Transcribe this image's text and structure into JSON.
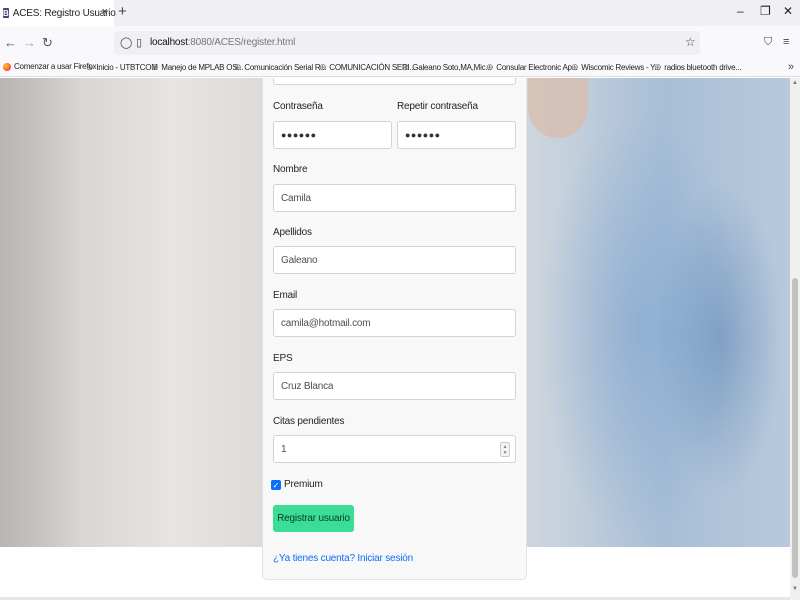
{
  "browser": {
    "tab_title": "ACES: Registro Usuario",
    "tab_close": "×",
    "new_tab": "+",
    "favicon_letter": "B",
    "window_controls": {
      "minimize": "–",
      "restore": "❐",
      "close": "✕"
    },
    "url_host": "localhost",
    "url_rest": ":8080/ACES/register.html",
    "bookmarks": [
      "Comenzar a usar Firefox",
      "Inicio - UTBTCOM",
      "Manejo de MPLAB OS...",
      "Comunicación Serial R...",
      "COMUNICACIÓN SERI...",
      "Galeano Soto,MA,Mic...",
      "Consular Electronic Ap...",
      "Wiscomic Reviews - Y...",
      "radios bluetooth drive..."
    ],
    "bookmarks_more": "»"
  },
  "form": {
    "password_label": "Contraseña",
    "repeat_password_label": "Repetir contraseña",
    "password_value": "●●●●●●",
    "repeat_password_value": "●●●●●●",
    "name_label": "Nombre",
    "name_value": "Camila",
    "lastname_label": "Apellidos",
    "lastname_value": "Galeano",
    "email_label": "Email",
    "email_value": "camila@hotmail.com",
    "eps_label": "EPS",
    "eps_value": "Cruz Blanca",
    "appointments_label": "Citas pendientes",
    "appointments_value": "1",
    "premium_label": "Premium",
    "premium_checked": true,
    "submit_label": "Registrar usuario",
    "login_link": "¿Ya tienes cuenta? Iniciar sesión"
  },
  "colors": {
    "button_bg": "#3bdd96",
    "link": "#0d6efd",
    "checkbox": "#0d6efd",
    "favicon": "#563d7c"
  }
}
